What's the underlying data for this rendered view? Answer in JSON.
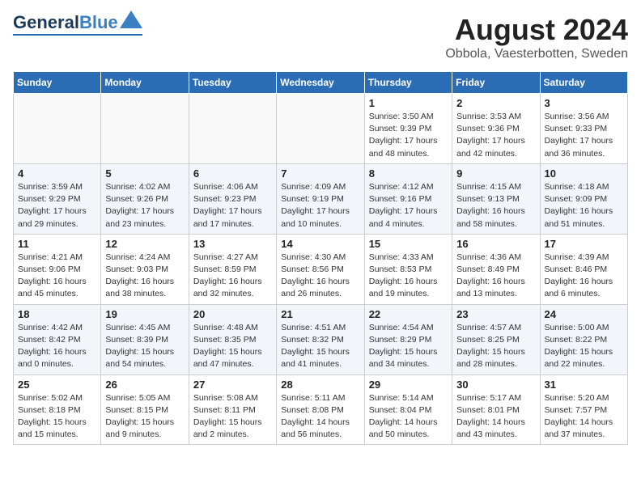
{
  "logo": {
    "line1": "General",
    "line2": "Blue"
  },
  "header": {
    "month": "August 2024",
    "location": "Obbola, Vaesterbotten, Sweden"
  },
  "days_of_week": [
    "Sunday",
    "Monday",
    "Tuesday",
    "Wednesday",
    "Thursday",
    "Friday",
    "Saturday"
  ],
  "weeks": [
    [
      {
        "day": "",
        "info": ""
      },
      {
        "day": "",
        "info": ""
      },
      {
        "day": "",
        "info": ""
      },
      {
        "day": "",
        "info": ""
      },
      {
        "day": "1",
        "info": "Sunrise: 3:50 AM\nSunset: 9:39 PM\nDaylight: 17 hours\nand 48 minutes."
      },
      {
        "day": "2",
        "info": "Sunrise: 3:53 AM\nSunset: 9:36 PM\nDaylight: 17 hours\nand 42 minutes."
      },
      {
        "day": "3",
        "info": "Sunrise: 3:56 AM\nSunset: 9:33 PM\nDaylight: 17 hours\nand 36 minutes."
      }
    ],
    [
      {
        "day": "4",
        "info": "Sunrise: 3:59 AM\nSunset: 9:29 PM\nDaylight: 17 hours\nand 29 minutes."
      },
      {
        "day": "5",
        "info": "Sunrise: 4:02 AM\nSunset: 9:26 PM\nDaylight: 17 hours\nand 23 minutes."
      },
      {
        "day": "6",
        "info": "Sunrise: 4:06 AM\nSunset: 9:23 PM\nDaylight: 17 hours\nand 17 minutes."
      },
      {
        "day": "7",
        "info": "Sunrise: 4:09 AM\nSunset: 9:19 PM\nDaylight: 17 hours\nand 10 minutes."
      },
      {
        "day": "8",
        "info": "Sunrise: 4:12 AM\nSunset: 9:16 PM\nDaylight: 17 hours\nand 4 minutes."
      },
      {
        "day": "9",
        "info": "Sunrise: 4:15 AM\nSunset: 9:13 PM\nDaylight: 16 hours\nand 58 minutes."
      },
      {
        "day": "10",
        "info": "Sunrise: 4:18 AM\nSunset: 9:09 PM\nDaylight: 16 hours\nand 51 minutes."
      }
    ],
    [
      {
        "day": "11",
        "info": "Sunrise: 4:21 AM\nSunset: 9:06 PM\nDaylight: 16 hours\nand 45 minutes."
      },
      {
        "day": "12",
        "info": "Sunrise: 4:24 AM\nSunset: 9:03 PM\nDaylight: 16 hours\nand 38 minutes."
      },
      {
        "day": "13",
        "info": "Sunrise: 4:27 AM\nSunset: 8:59 PM\nDaylight: 16 hours\nand 32 minutes."
      },
      {
        "day": "14",
        "info": "Sunrise: 4:30 AM\nSunset: 8:56 PM\nDaylight: 16 hours\nand 26 minutes."
      },
      {
        "day": "15",
        "info": "Sunrise: 4:33 AM\nSunset: 8:53 PM\nDaylight: 16 hours\nand 19 minutes."
      },
      {
        "day": "16",
        "info": "Sunrise: 4:36 AM\nSunset: 8:49 PM\nDaylight: 16 hours\nand 13 minutes."
      },
      {
        "day": "17",
        "info": "Sunrise: 4:39 AM\nSunset: 8:46 PM\nDaylight: 16 hours\nand 6 minutes."
      }
    ],
    [
      {
        "day": "18",
        "info": "Sunrise: 4:42 AM\nSunset: 8:42 PM\nDaylight: 16 hours\nand 0 minutes."
      },
      {
        "day": "19",
        "info": "Sunrise: 4:45 AM\nSunset: 8:39 PM\nDaylight: 15 hours\nand 54 minutes."
      },
      {
        "day": "20",
        "info": "Sunrise: 4:48 AM\nSunset: 8:35 PM\nDaylight: 15 hours\nand 47 minutes."
      },
      {
        "day": "21",
        "info": "Sunrise: 4:51 AM\nSunset: 8:32 PM\nDaylight: 15 hours\nand 41 minutes."
      },
      {
        "day": "22",
        "info": "Sunrise: 4:54 AM\nSunset: 8:29 PM\nDaylight: 15 hours\nand 34 minutes."
      },
      {
        "day": "23",
        "info": "Sunrise: 4:57 AM\nSunset: 8:25 PM\nDaylight: 15 hours\nand 28 minutes."
      },
      {
        "day": "24",
        "info": "Sunrise: 5:00 AM\nSunset: 8:22 PM\nDaylight: 15 hours\nand 22 minutes."
      }
    ],
    [
      {
        "day": "25",
        "info": "Sunrise: 5:02 AM\nSunset: 8:18 PM\nDaylight: 15 hours\nand 15 minutes."
      },
      {
        "day": "26",
        "info": "Sunrise: 5:05 AM\nSunset: 8:15 PM\nDaylight: 15 hours\nand 9 minutes."
      },
      {
        "day": "27",
        "info": "Sunrise: 5:08 AM\nSunset: 8:11 PM\nDaylight: 15 hours\nand 2 minutes."
      },
      {
        "day": "28",
        "info": "Sunrise: 5:11 AM\nSunset: 8:08 PM\nDaylight: 14 hours\nand 56 minutes."
      },
      {
        "day": "29",
        "info": "Sunrise: 5:14 AM\nSunset: 8:04 PM\nDaylight: 14 hours\nand 50 minutes."
      },
      {
        "day": "30",
        "info": "Sunrise: 5:17 AM\nSunset: 8:01 PM\nDaylight: 14 hours\nand 43 minutes."
      },
      {
        "day": "31",
        "info": "Sunrise: 5:20 AM\nSunset: 7:57 PM\nDaylight: 14 hours\nand 37 minutes."
      }
    ]
  ]
}
